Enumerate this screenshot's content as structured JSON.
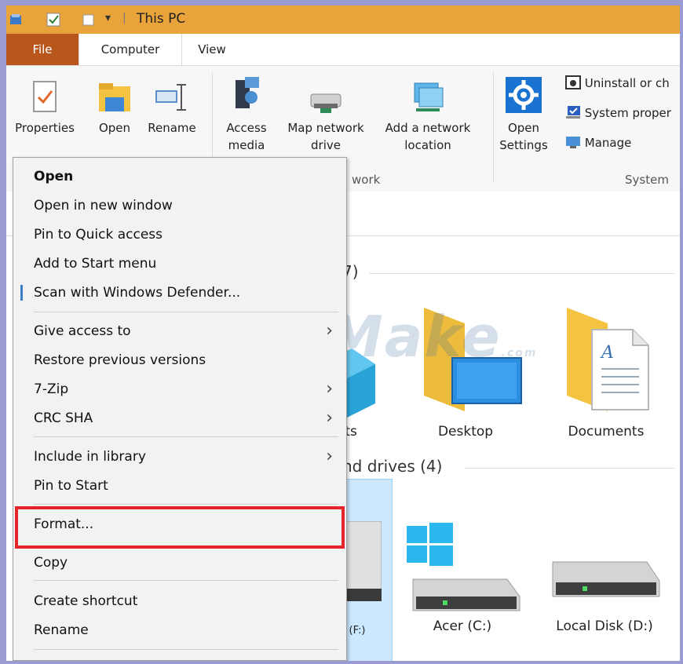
{
  "window": {
    "title": "This PC",
    "accent": "#e8a43a"
  },
  "tabs": [
    {
      "label": "File"
    },
    {
      "label": "Computer"
    },
    {
      "label": "View"
    }
  ],
  "ribbon": {
    "location": {
      "properties": "Properties",
      "open": "Open",
      "rename": "Rename"
    },
    "network": {
      "access_media": "Access media",
      "map_network_drive": "Map network drive",
      "add_network_location_1": "Add a network",
      "add_network_location_2": "location",
      "group_label": "work"
    },
    "system": {
      "open_settings_1": "Open",
      "open_settings_2": "Settings",
      "uninstall": "Uninstall or ch",
      "system_properties": "System proper",
      "manage": "Manage",
      "group_label": "System"
    }
  },
  "content": {
    "folders_header_fragment": "7)",
    "drives_header_fragment": "nd drives (4)",
    "folders": [
      {
        "label": "cts"
      },
      {
        "label": "Desktop"
      },
      {
        "label": "Documents"
      }
    ],
    "drives": [
      {
        "label": "(F:)"
      },
      {
        "label": "Acer (C:)"
      },
      {
        "label": "Local Disk (D:)"
      }
    ]
  },
  "watermark": {
    "text": "TipsMake",
    "suffix": ".com"
  },
  "context_menu": {
    "items": [
      {
        "label": "Open"
      },
      {
        "label": "Open in new window"
      },
      {
        "label": "Pin to Quick access"
      },
      {
        "label": "Add to Start menu"
      },
      {
        "label": "Scan with Windows Defender..."
      },
      {
        "label": "Give access to"
      },
      {
        "label": "Restore previous versions"
      },
      {
        "label": "7-Zip"
      },
      {
        "label": "CRC SHA"
      },
      {
        "label": "Include in library"
      },
      {
        "label": "Pin to Start"
      },
      {
        "label": "Format..."
      },
      {
        "label": "Copy"
      },
      {
        "label": "Create shortcut"
      },
      {
        "label": "Rename"
      }
    ],
    "highlight_color": "#e3242b"
  }
}
